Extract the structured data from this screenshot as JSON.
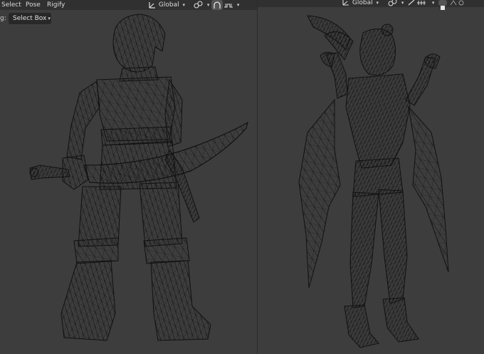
{
  "header": {
    "menu": [
      {
        "label": "Select"
      },
      {
        "label": "Pose"
      },
      {
        "label": "Rigify"
      }
    ],
    "transform_orientation": "Global",
    "right_transform_orientation": "Global"
  },
  "tool_settings": {
    "label_fragment": "g:",
    "select_mode": "Select Box"
  },
  "icons": [
    "transform-orientation-icon",
    "pivot-link-icon",
    "snap-icon",
    "proportional-icon",
    "chevron-down-icon",
    "overlay-icon",
    "shading-icon"
  ],
  "colors": {
    "viewport_bg": "#3d3d3d",
    "header_bg": "#303030",
    "wire": "#0f0f0f",
    "pill_active": "#545454"
  }
}
